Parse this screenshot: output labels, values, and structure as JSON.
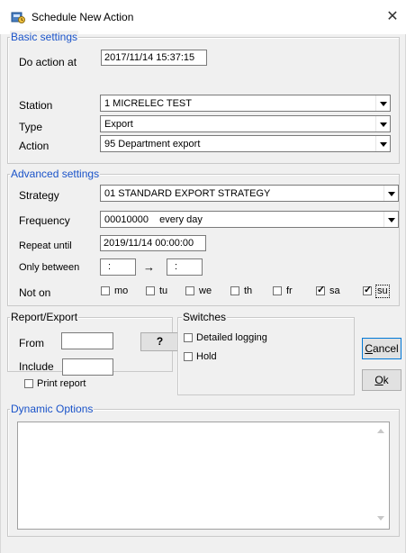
{
  "window": {
    "title": "Schedule New Action",
    "close_glyph": "✕"
  },
  "basic": {
    "legend": "Basic settings",
    "do_action_at_label": "Do action at",
    "do_action_at_value": "2017/11/14  15:37:15",
    "station_label": "Station",
    "station_value": "1  MICRELEC TEST",
    "type_label": "Type",
    "type_value": "Export",
    "action_label": "Action",
    "action_value": "95  Department export"
  },
  "advanced": {
    "legend": "Advanced settings",
    "strategy_label": "Strategy",
    "strategy_value": "01  STANDARD EXPORT STRATEGY",
    "frequency_label": "Frequency",
    "frequency_value": "00010000    every day",
    "repeat_until_label": "Repeat until",
    "repeat_until_value": "2019/11/14  00:00:00",
    "only_between_label": "Only between",
    "only_between_from": ":",
    "only_between_arrow": "→",
    "only_between_to": ":",
    "not_on_label": "Not on",
    "days": [
      {
        "label": "mo",
        "checked": false
      },
      {
        "label": "tu",
        "checked": false
      },
      {
        "label": "we",
        "checked": false
      },
      {
        "label": "th",
        "checked": false
      },
      {
        "label": "fr",
        "checked": false
      },
      {
        "label": "sa",
        "checked": true
      },
      {
        "label": "su",
        "checked": true
      }
    ]
  },
  "report": {
    "legend": "Report/Export",
    "from_label": "From",
    "from_value": "",
    "browse_label": "?",
    "include_label": "Include",
    "include_value": "",
    "print_report_label": "Print report",
    "print_report_checked": false
  },
  "switches": {
    "legend": "Switches",
    "detailed_logging_label": "Detailed logging",
    "detailed_logging_checked": false,
    "hold_label": "Hold",
    "hold_checked": false
  },
  "buttons": {
    "cancel_label": "Cancel",
    "cancel_mnemonic": "C",
    "cancel_rest": "ancel",
    "ok_label": "Ok",
    "ok_mnemonic": "O",
    "ok_rest": "k"
  },
  "dynamic": {
    "legend": "Dynamic Options",
    "text": ""
  },
  "colors": {
    "legend_blue": "#1a53c9",
    "default_button_border": "#0078d7"
  }
}
